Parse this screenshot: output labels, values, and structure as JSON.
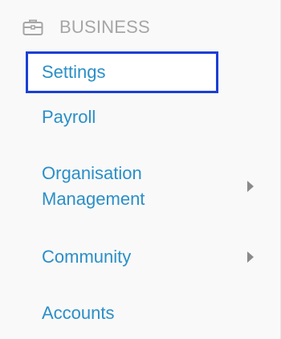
{
  "section": {
    "icon": "briefcase-icon",
    "title": "BUSINESS"
  },
  "nav": {
    "items": [
      {
        "label": "Settings",
        "selected": true,
        "has_submenu": false
      },
      {
        "label": "Payroll",
        "selected": false,
        "has_submenu": false
      },
      {
        "label": "Organisation Management",
        "label_line1": "Organisation",
        "label_line2": "Management",
        "selected": false,
        "has_submenu": true
      },
      {
        "label": "Community",
        "selected": false,
        "has_submenu": true
      },
      {
        "label": "Accounts",
        "selected": false,
        "has_submenu": false
      }
    ]
  },
  "colors": {
    "link": "#2a8fc8",
    "header": "#a6a6a6",
    "focus_border": "#1a3fd6",
    "chevron": "#8a8a8a",
    "background": "#f9f9f9"
  }
}
